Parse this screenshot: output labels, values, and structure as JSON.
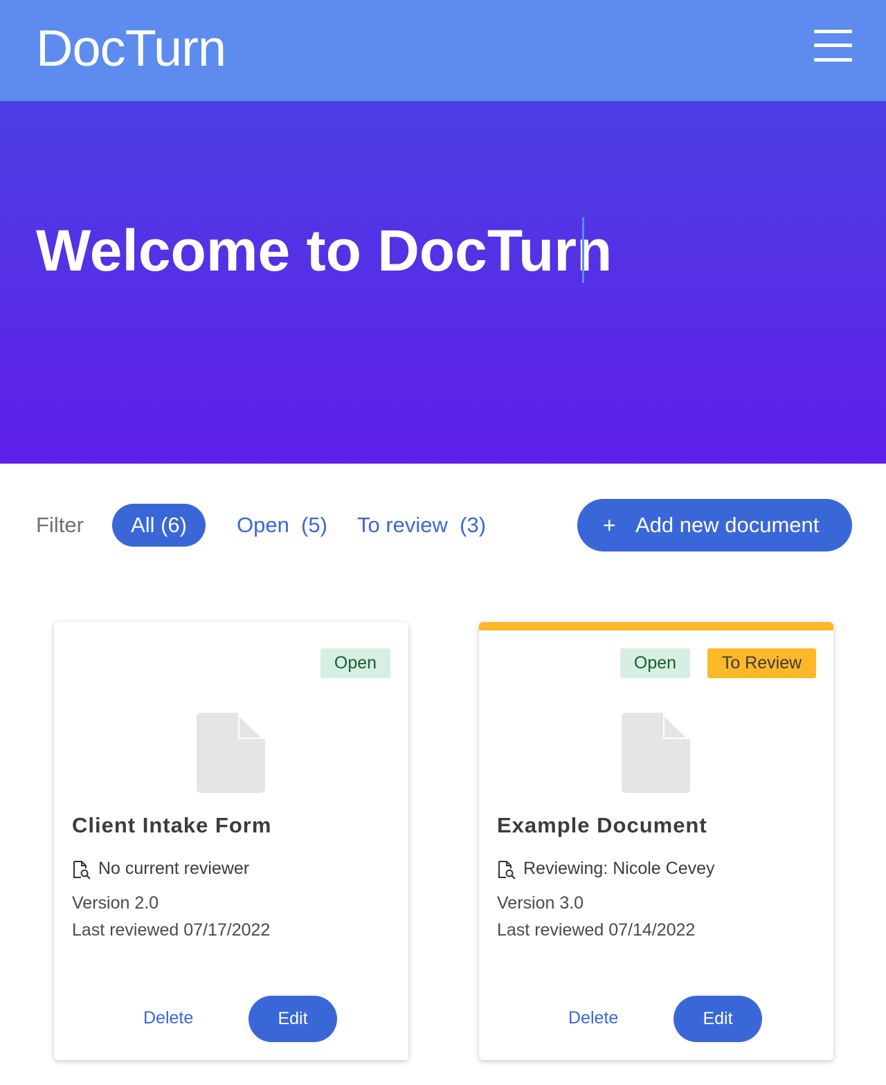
{
  "header": {
    "brand": "DocTurn",
    "menu_icon": "hamburger-menu-icon",
    "bg_color": "#5d8cee"
  },
  "hero": {
    "title": "Welcome to DocTurn",
    "gradient": [
      "#4c3fe2",
      "#5f1fe9"
    ]
  },
  "filter": {
    "label": "Filter",
    "options": [
      {
        "label": "All (6)",
        "active": true
      },
      {
        "label": "Open  (5)",
        "active": false
      },
      {
        "label": "To review  (3)",
        "active": false
      }
    ]
  },
  "actions": {
    "add_plus": "+",
    "add_label": "Add new document",
    "accent_color": "#3a67d8"
  },
  "documents": [
    {
      "title": "Client Intake Form",
      "badges": [
        "Open"
      ],
      "reviewer": "No current reviewer",
      "version": "Version 2.0",
      "last_reviewed": "Last reviewed 07/17/2022",
      "delete_label": "Delete",
      "edit_label": "Edit",
      "flagged": false
    },
    {
      "title": "Example Document",
      "badges": [
        "Open",
        "To Review"
      ],
      "reviewer": "Reviewing: Nicole Cevey",
      "version": "Version 3.0",
      "last_reviewed": "Last reviewed 07/14/2022",
      "delete_label": "Delete",
      "edit_label": "Edit",
      "flagged": true
    }
  ],
  "colors": {
    "open_badge_bg": "#d6efe0",
    "open_badge_text": "#1a5c33",
    "review_badge_bg": "#fcb828"
  }
}
